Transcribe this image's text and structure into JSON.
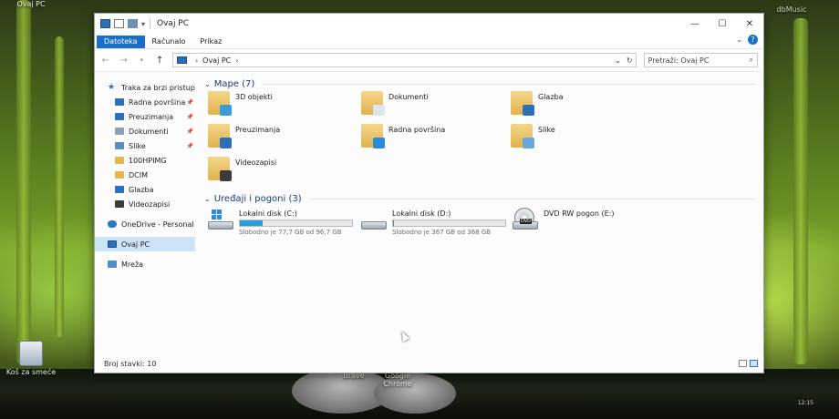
{
  "desktop": {
    "top_icon_label": "Ovaj PC",
    "recycle_label": "Koš za smeće",
    "taskbar_icons": [
      {
        "label": "Brave"
      },
      {
        "label": "Google Chrome"
      }
    ],
    "top_right_label": "dbMusic",
    "clock": "12:15"
  },
  "window": {
    "title": "Ovaj PC",
    "controls": {
      "minimize": "—",
      "maximize": "☐",
      "close": "✕"
    },
    "ribbon": {
      "tabs": [
        "Datoteka",
        "Računalo",
        "Prikaz"
      ],
      "active_tab": "Datoteka"
    },
    "address": {
      "path": "Ovaj PC",
      "search_placeholder": "Pretraži: Ovaj PC"
    },
    "nav": {
      "quick_access": "Traka za brzi pristup",
      "items": [
        {
          "label": "Radna površina",
          "icon": "desktop-icon",
          "pinned": true,
          "color": "#2b6fb8"
        },
        {
          "label": "Preuzimanja",
          "icon": "download-icon",
          "pinned": true,
          "color": "#2b6fb8"
        },
        {
          "label": "Dokumenti",
          "icon": "documents-icon",
          "pinned": true,
          "color": "#8aa0b8"
        },
        {
          "label": "Slike",
          "icon": "pictures-icon",
          "pinned": true,
          "color": "#5a8fc4"
        },
        {
          "label": "100HPIMG",
          "icon": "folder-icon",
          "pinned": false,
          "color": "#e6b54c"
        },
        {
          "label": "DCIM",
          "icon": "folder-icon",
          "pinned": false,
          "color": "#e6b54c"
        },
        {
          "label": "Glazba",
          "icon": "music-icon",
          "pinned": false,
          "color": "#2b6fb8"
        },
        {
          "label": "Videozapisi",
          "icon": "videos-icon",
          "pinned": false,
          "color": "#3a3a3a"
        }
      ],
      "onedrive": "OneDrive - Personal",
      "this_pc": "Ovaj PC",
      "network": "Mreža"
    },
    "folders_header": "Mape (7)",
    "folders": [
      {
        "label": "3D objekti",
        "icon": "3d-objects-icon",
        "overlay_color": "#3a9bd9"
      },
      {
        "label": "Dokumenti",
        "icon": "documents-folder-icon",
        "overlay_color": "#dfe5ec"
      },
      {
        "label": "Glazba",
        "icon": "music-folder-icon",
        "overlay_color": "#2b6fb8"
      },
      {
        "label": "Preuzimanja",
        "icon": "downloads-folder-icon",
        "overlay_color": "#2b6fb8"
      },
      {
        "label": "Radna površina",
        "icon": "desktop-folder-icon",
        "overlay_color": "#2a8ad6"
      },
      {
        "label": "Slike",
        "icon": "pictures-folder-icon",
        "overlay_color": "#6aa6d9"
      },
      {
        "label": "Videozapisi",
        "icon": "videos-folder-icon",
        "overlay_color": "#3b3b3b"
      }
    ],
    "drives_header": "Uređaji i pogoni (3)",
    "drives": [
      {
        "name": "Lokalni disk (C:)",
        "free_text": "Slobodno je 77,7 GB od 96,7 GB",
        "used_fraction": 0.2,
        "icon": "windows-drive-icon"
      },
      {
        "name": "Lokalni disk (D:)",
        "free_text": "Slobodno je 367 GB od 368 GB",
        "used_fraction": 0.003,
        "icon": "hard-drive-icon"
      },
      {
        "name": "DVD RW pogon (E:)",
        "icon": "dvd-drive-icon"
      }
    ],
    "dvd_badge": "DVD",
    "status": "Broj stavki: 10"
  }
}
